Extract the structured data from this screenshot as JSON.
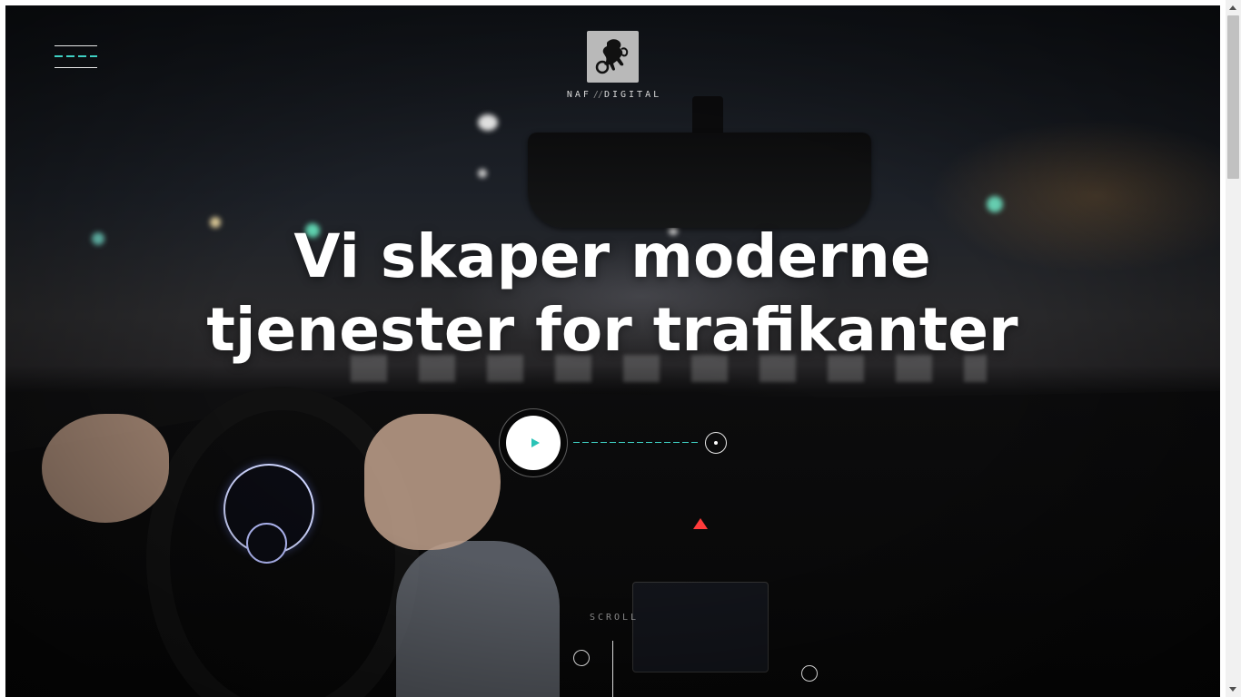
{
  "header": {
    "menu_icon": "hamburger-menu-icon",
    "logo": {
      "icon": "lion-emblem-icon",
      "text_left": "NAF",
      "separator": "//",
      "text_right": "DIGITAL"
    }
  },
  "hero": {
    "headline_line1": "Vi skaper moderne",
    "headline_line2": "tjenester for trafikanter",
    "play_icon": "play-icon"
  },
  "footer": {
    "scroll_label": "SCROLL"
  },
  "colors": {
    "accent": "#3fd1c4",
    "text": "#ffffff",
    "logo_background": "#b9b9b9"
  }
}
